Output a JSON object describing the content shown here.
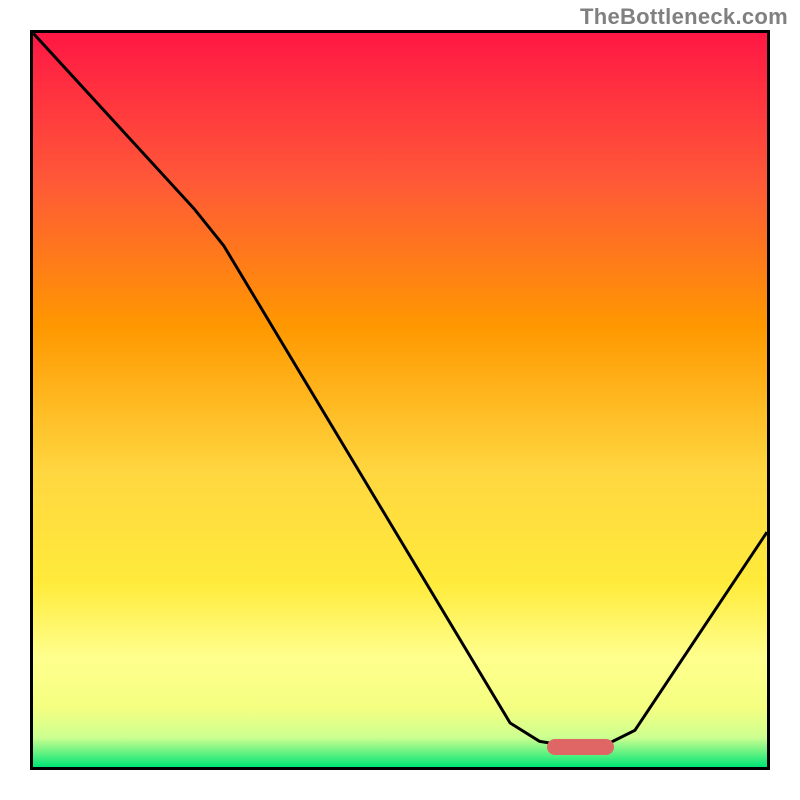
{
  "watermark": "TheBottleneck.com",
  "chart_data": {
    "type": "line",
    "title": "",
    "xlabel": "",
    "ylabel": "",
    "xlim": [
      0,
      100
    ],
    "ylim": [
      0,
      100
    ],
    "gradient_colors": [
      {
        "pos": 0,
        "color": "#ff1744"
      },
      {
        "pos": 20,
        "color": "#ff5838"
      },
      {
        "pos": 40,
        "color": "#ff9800"
      },
      {
        "pos": 60,
        "color": "#ffd740"
      },
      {
        "pos": 75,
        "color": "#ffeb3b"
      },
      {
        "pos": 85,
        "color": "#ffff8d"
      },
      {
        "pos": 92,
        "color": "#f4ff81"
      },
      {
        "pos": 96,
        "color": "#ccff90"
      },
      {
        "pos": 100,
        "color": "#00e676"
      }
    ],
    "series": [
      {
        "name": "bottleneck-curve",
        "points": [
          {
            "x": 0,
            "y": 100
          },
          {
            "x": 22,
            "y": 76
          },
          {
            "x": 26,
            "y": 71
          },
          {
            "x": 65,
            "y": 6
          },
          {
            "x": 69,
            "y": 3.5
          },
          {
            "x": 72,
            "y": 3
          },
          {
            "x": 78,
            "y": 3
          },
          {
            "x": 82,
            "y": 5
          },
          {
            "x": 100,
            "y": 32
          }
        ]
      }
    ],
    "marker": {
      "x": 74,
      "y": 3.5,
      "width": 9,
      "height": 2.2
    }
  }
}
